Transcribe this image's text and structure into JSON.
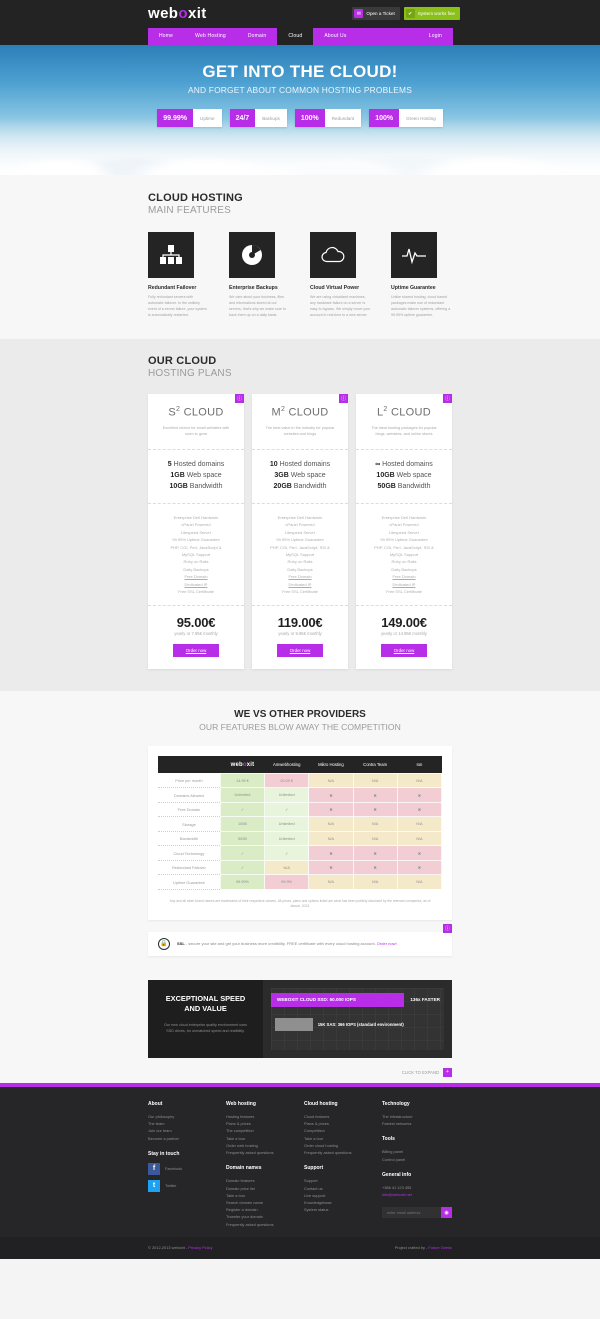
{
  "brand": {
    "name_pre": "web",
    "name_o": "o",
    "name_post": "xit"
  },
  "topbar": {
    "ticket_label": "Open a Ticket",
    "ticket_icon": "envelope-icon",
    "status_label": "System works fine",
    "status_icon": "check-icon"
  },
  "nav": {
    "items": [
      {
        "label": "Home",
        "active": false
      },
      {
        "label": "Web Hosting",
        "active": false
      },
      {
        "label": "Domain",
        "active": false
      },
      {
        "label": "Cloud",
        "active": true
      },
      {
        "label": "About Us",
        "active": false
      }
    ],
    "login": "Login"
  },
  "hero": {
    "title": "GET INTO THE CLOUD!",
    "subtitle": "AND FORGET ABOUT COMMON HOSTING PROBLEMS",
    "badges": [
      {
        "value": "99.99%",
        "label": "Uptime"
      },
      {
        "value": "24/7",
        "label": "Backups"
      },
      {
        "value": "100%",
        "label": "Redundant"
      },
      {
        "value": "100%",
        "label": "Green Hosting"
      }
    ]
  },
  "features": {
    "title": "CLOUD HOSTING",
    "subtitle": "MAIN FEATURES",
    "items": [
      {
        "icon": "server-rack-icon",
        "title": "Redundant Failover",
        "text": "Fully redundant servers with automatic failover. In the unlikely event of a server failure, your system is automatically restarted."
      },
      {
        "icon": "pie-chart-icon",
        "title": "Enterprise Backups",
        "text": "We care about your business, files and informations stored at our servers, that's why we make sure to back them up on a daily basis."
      },
      {
        "icon": "cloud-icon",
        "title": "Cloud Virtual Power",
        "text": "We are using virtualized machines, any hardware failure on a server is easy to bypass. We simply move your account in real time to a new server."
      },
      {
        "icon": "pulse-icon",
        "title": "Uptime Guarantee",
        "text": "Unlike shared hosting, cloud based packages make use of redundant automatic failover systems, offering a 99.99% uptime guarantee."
      }
    ]
  },
  "plans": {
    "title": "OUR CLOUD",
    "subtitle": "HOSTING PLANS",
    "info_icon": "info-icon",
    "items": [
      {
        "name": "S",
        "exp": "2",
        "suffix": " CLOUD",
        "desc": "Excellent choice for small websites with room to grow",
        "specs": [
          {
            "b": "5",
            "t": " Hosted domains"
          },
          {
            "b": "1GB",
            "t": " Web space"
          },
          {
            "b": "10GB",
            "t": " Bandwidth"
          }
        ],
        "features": [
          "Enterprise Dell Hardware",
          "cPanel Powered",
          "Litespeed Server",
          "99.99% Uptime Guarantee",
          "PHP, CGI, Perl, JavaScript &",
          "MySQL Support",
          "Ruby on Rails",
          "Daily Backups",
          "Free Domain",
          "Dedicated IP",
          "Free SSL Certificate"
        ],
        "underline": [
          8,
          9
        ],
        "price": "95.00€",
        "per": "yearly or 7.95€ monthly",
        "order": "Order now"
      },
      {
        "name": "M",
        "exp": "2",
        "suffix": " CLOUD",
        "desc": "The best value in the industry for popular websites and blogs",
        "specs": [
          {
            "b": "10",
            "t": " Hosted domains"
          },
          {
            "b": "3GB",
            "t": " Web space"
          },
          {
            "b": "20GB",
            "t": " Bandwidth"
          }
        ],
        "features": [
          "Enterprise Dell Hardware",
          "cPanel Powered",
          "Litespeed Server",
          "99.99% Uptime Guarantee",
          "PHP, CGI, Perl, JavaScript, SSI &",
          "MySQL Support",
          "Ruby on Rails",
          "Daily Backups",
          "Free Domain",
          "Dedicated IP",
          "Free SSL Certificate"
        ],
        "underline": [
          8,
          9
        ],
        "price": "119.00€",
        "per": "yearly or 9.95€ monthly",
        "order": "Order now"
      },
      {
        "name": "L",
        "exp": "2",
        "suffix": " CLOUD",
        "desc": "The ideal hosting packages for popular blogs, websites, and online stores",
        "specs": [
          {
            "b": "∞",
            "t": " Hosted domains"
          },
          {
            "b": "10GB",
            "t": " Web space"
          },
          {
            "b": "50GB",
            "t": " Bandwidth"
          }
        ],
        "features": [
          "Enterprise Dell Hardware",
          "cPanel Powered",
          "Litespeed Server",
          "99.99% Uptime Guarantee",
          "PHP, CGI, Perl, JavaScript, SSI &",
          "MySQL Support",
          "Ruby on Rails",
          "Daily Backups",
          "Free Domain",
          "Dedicated IP",
          "Free SSL Certificate"
        ],
        "underline": [
          8,
          9
        ],
        "price": "149.00€",
        "per": "yearly or 14.95€ monthly",
        "order": "Order now"
      }
    ]
  },
  "comparison": {
    "title": "WE VS OTHER PROVIDERS",
    "subtitle": "OUR FEATURES BLOW AWAY THE COMPETITION",
    "columns": [
      "",
      "weboxit",
      "Amwebhosting",
      "Mikro Hosting",
      "Contra Team",
      "Ion"
    ],
    "rows": [
      {
        "label": "Price per month",
        "cells": [
          {
            "v": "14.95 €",
            "c": "g"
          },
          {
            "v": "20.00 €",
            "c": "r"
          },
          {
            "v": "N/A",
            "c": "y"
          },
          {
            "v": "N/A",
            "c": "y"
          },
          {
            "v": "N/A",
            "c": "y"
          }
        ]
      },
      {
        "label": "Domains Allowed",
        "cells": [
          {
            "v": "Unlimited",
            "c": "g"
          },
          {
            "v": "Unlimited",
            "c": "g2"
          },
          {
            "v": "✖",
            "c": "r"
          },
          {
            "v": "✖",
            "c": "r"
          },
          {
            "v": "✖",
            "c": "r"
          }
        ]
      },
      {
        "label": "Free Domain",
        "cells": [
          {
            "v": "✓",
            "c": "g"
          },
          {
            "v": "✓",
            "c": "g2"
          },
          {
            "v": "✖",
            "c": "r"
          },
          {
            "v": "✖",
            "c": "r"
          },
          {
            "v": "✖",
            "c": "r"
          }
        ]
      },
      {
        "label": "Storage",
        "cells": [
          {
            "v": "100B",
            "c": "g"
          },
          {
            "v": "Unlimited",
            "c": "g2"
          },
          {
            "v": "N/A",
            "c": "y"
          },
          {
            "v": "N/A",
            "c": "y"
          },
          {
            "v": "N/A",
            "c": "y"
          }
        ]
      },
      {
        "label": "Bandwidth",
        "cells": [
          {
            "v": "500B",
            "c": "g"
          },
          {
            "v": "Unlimited",
            "c": "g2"
          },
          {
            "v": "N/A",
            "c": "y"
          },
          {
            "v": "N/A",
            "c": "y"
          },
          {
            "v": "N/A",
            "c": "y"
          }
        ]
      },
      {
        "label": "Cloud Technology",
        "cells": [
          {
            "v": "✓",
            "c": "g"
          },
          {
            "v": "✓",
            "c": "g2"
          },
          {
            "v": "✖",
            "c": "r"
          },
          {
            "v": "✖",
            "c": "r"
          },
          {
            "v": "✖",
            "c": "r"
          }
        ]
      },
      {
        "label": "Redundant Failover",
        "cells": [
          {
            "v": "✓",
            "c": "g"
          },
          {
            "v": "N/A",
            "c": "y"
          },
          {
            "v": "✖",
            "c": "r"
          },
          {
            "v": "✖",
            "c": "r"
          },
          {
            "v": "✖",
            "c": "r"
          }
        ]
      },
      {
        "label": "Uptime Guarantee",
        "cells": [
          {
            "v": "99.99%",
            "c": "g"
          },
          {
            "v": "99.9%",
            "c": "r"
          },
          {
            "v": "N/A",
            "c": "y"
          },
          {
            "v": "N/A",
            "c": "y"
          },
          {
            "v": "N/A",
            "c": "y"
          }
        ]
      }
    ],
    "note": "Any and all other brand names are trademarks of their respective owners. All prices, plans and options listed are what has been publicly disclosed by the relevant companies, as of Januar, 2013."
  },
  "ssl": {
    "icon": "lock-icon",
    "strong": "SSL",
    "text": " - secure your site and get your business more credibility. FREE certificate with every cloud hosting account. ",
    "link": "Order now!",
    "info_icon": "info-icon"
  },
  "speed": {
    "title_line1": "EXCEPTIONAL SPEED",
    "title_line2": "AND VALUE",
    "text": "Our new cloud enterprise quality environment uses SSD drives, for unmatched speed and realibility.",
    "expand_label": "CLICK TO EXPAND",
    "expand_icon": "plus-icon",
    "chart_data": {
      "type": "bar",
      "title": "SSD vs SAS IOPS comparison",
      "categories": [
        "WEBOXIT CLOUD SSD: 50.000 IOPS",
        "15K SAS: 366 IOPS (standard environment)"
      ],
      "values": [
        50000,
        366
      ],
      "annotations": [
        "136x FASTER"
      ],
      "xlabel": "",
      "ylabel": "IOPS",
      "grid": true
    }
  },
  "footer": {
    "cols": [
      {
        "title": "About",
        "links": [
          "Our philosophy",
          "The team",
          "Join our team",
          "Become a partner"
        ],
        "title2": "Stay in touch",
        "social": [
          {
            "icon": "facebook-icon",
            "label": "Facebook",
            "glyph": "f"
          },
          {
            "icon": "twitter-icon",
            "label": "Twitter",
            "glyph": "t"
          }
        ]
      },
      {
        "title": "Web hosting",
        "links": [
          "Hosting features",
          "Plans & prices",
          "The competition",
          "Take a tour",
          "Order web hosting",
          "Frequently asked questions"
        ],
        "title2": "Domain names",
        "links2": [
          "Domain features",
          "Domain price list",
          "Take a tour",
          "Search domain name",
          "Register a domain",
          "Transfer your domain",
          "Frequently asked questions"
        ]
      },
      {
        "title": "Cloud hosting",
        "links": [
          "Cloud features",
          "Plans & prices",
          "Competition",
          "Take a tour",
          "Order cloud hosting",
          "Frequently asked questions"
        ],
        "title2": "Support",
        "links2": [
          "Support",
          "Contact us",
          "Live support",
          "Knowledgebase",
          "System status"
        ]
      },
      {
        "title": "Technology",
        "links": [
          "The infrastructure",
          "Fastest networks"
        ],
        "title2": "Tools",
        "links2": [
          "Billing panel",
          "Control panel"
        ],
        "title3": "General info",
        "phone": "+386 41 123 455",
        "email": "info@weboxit.net",
        "newsletter_placeholder": "enter email address",
        "newsletter_icon": "send-icon"
      }
    ],
    "copyright": "© 2012-2013 weboxit - ",
    "privacy": "Privacy Policy",
    "crafted": "Project crafted by - ",
    "crafted_link": "Future Geeks"
  }
}
